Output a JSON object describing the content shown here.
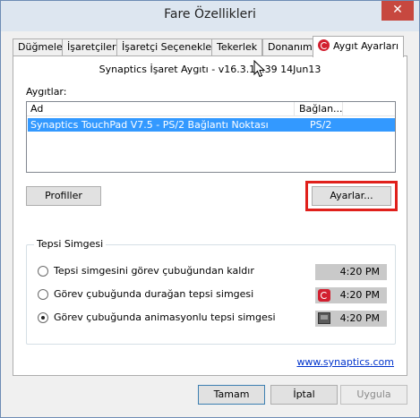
{
  "window": {
    "title": "Fare Özellikleri",
    "close_glyph": "✕"
  },
  "tabs": [
    {
      "label": "Düğmeler"
    },
    {
      "label": "İşaretçiler"
    },
    {
      "label": "İşaretçi Seçenekleri"
    },
    {
      "label": "Tekerlek"
    },
    {
      "label": "Donanım"
    },
    {
      "label": "Aygıt Ayarları",
      "icon": "synaptics-icon",
      "active": true
    }
  ],
  "device_info": "Synaptics İşaret Aygıtı - v16.3.12.39 14Jun13",
  "devices": {
    "label": "Aygıtlar:",
    "columns": [
      "Ad",
      "Bağlan..."
    ],
    "rows": [
      {
        "name": "Synaptics TouchPad V7.5 - PS/2 Bağlantı Noktası",
        "connection": "PS/2",
        "selected": true
      }
    ]
  },
  "buttons": {
    "profiles": "Profiller",
    "settings": "Ayarlar...",
    "ok": "Tamam",
    "cancel": "İptal",
    "apply": "Uygula"
  },
  "tray_group": {
    "title": "Tepsi Simgesi",
    "options": [
      {
        "label": "Tepsi simgesini görev çubuğundan kaldır",
        "time": "4:20 PM",
        "icon": "none",
        "checked": false
      },
      {
        "label": "Görev çubuğunda durağan tepsi simgesi",
        "time": "4:20 PM",
        "icon": "synaptics-static-icon",
        "checked": false
      },
      {
        "label": "Görev çubuğunda animasyonlu tepsi simgesi",
        "time": "4:20 PM",
        "icon": "synaptics-animated-icon",
        "checked": true
      }
    ]
  },
  "link": "www.synaptics.com",
  "colors": {
    "highlight": "#e0201b",
    "selection": "#3399ff",
    "link": "#0033cc"
  }
}
